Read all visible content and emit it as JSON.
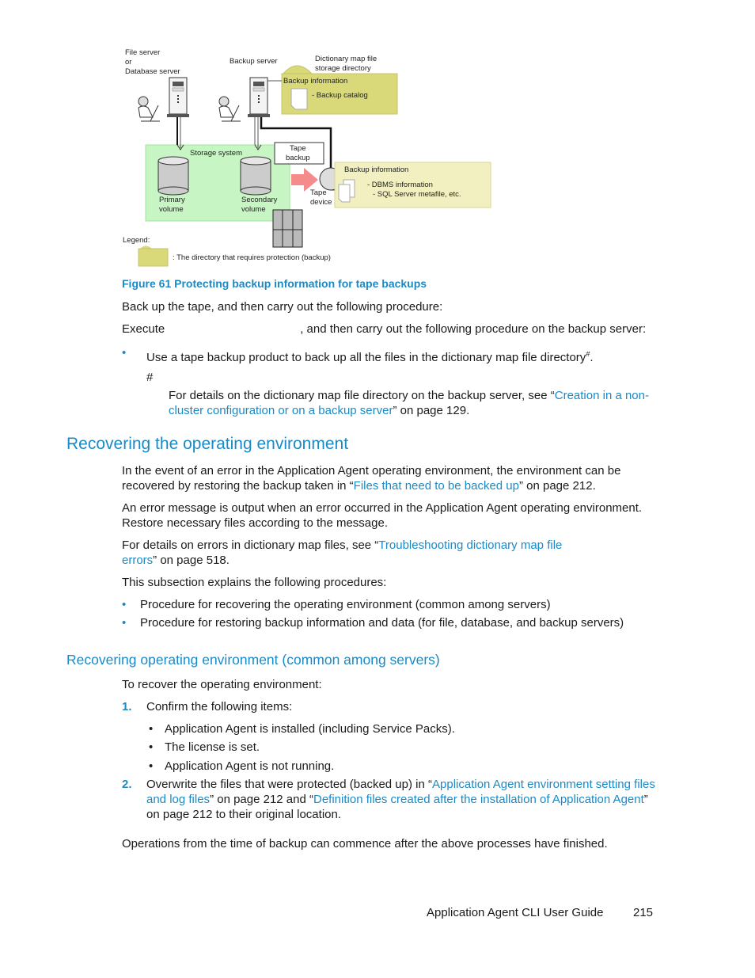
{
  "figure": {
    "labels": {
      "file_server": [
        "File server",
        "or",
        "Database server"
      ],
      "backup_server": "Backup server",
      "dict_dir": [
        "Dictionary map file",
        "storage directory"
      ],
      "backup_info_top": "Backup information",
      "backup_catalog": "- Backup catalog",
      "storage_system": "Storage system",
      "primary": [
        "Primary",
        "volume"
      ],
      "secondary": [
        "Secondary",
        "volume"
      ],
      "tape_backup": [
        "Tape",
        "backup"
      ],
      "tape_device": [
        "Tape",
        "device"
      ],
      "backup_info_bottom": "Backup information",
      "dbms_info": "- DBMS information",
      "sql_meta": "- SQL Server metafile, etc.",
      "legend": "Legend:",
      "legend_desc": ": The directory that requires protection (backup)"
    },
    "colors": {
      "protected_dir": "#d9d97a",
      "backup_info_box": "#f2f0c0",
      "storage_system": "#c8f5c4",
      "arrow": "#f48c8c"
    },
    "caption": "Figure 61 Protecting backup information for tape backups"
  },
  "body1": {
    "p1": "Back up the tape, and then carry out the following procedure:",
    "p2_start": "Execute",
    "p2_end": ", and then carry out the following procedure on the backup server:",
    "bullet": "Use a tape backup product to back up all the files in the dictionary map file directory",
    "bullet_sup": "#",
    "bullet_end": ".",
    "note_mark": "#",
    "note_text": "For details on the dictionary map file directory on the backup server, see “",
    "note_link": "Creation in a non-cluster configuration or on a backup server",
    "note_end": "” on page 129."
  },
  "section1": {
    "heading": "Recovering the operating environment",
    "p1_a": "In the event of an error in the Application Agent operating environment, the environment can be recovered by restoring the backup taken in “",
    "p1_link": "Files that need to be backed up",
    "p1_b": "” on page 212.",
    "p2": "An error message is output when an error occurred in the Application Agent operating environment. Restore necessary files according to the message.",
    "p3_a": "For details on errors in dictionary map files, see “",
    "p3_link": "Troubleshooting dictionary map file errors",
    "p3_b": "” on page 518.",
    "p4": "This subsection explains the following procedures:",
    "bullets": [
      "Procedure for recovering the operating environment (common among servers)",
      "Procedure for restoring backup information and data (for file, database, and backup servers)"
    ]
  },
  "section2": {
    "heading": "Recovering operating environment (common among servers)",
    "intro": "To recover the operating environment:",
    "step1_num": "1.",
    "step1": "Confirm the following items:",
    "step1_items": [
      "Application Agent is installed (including Service Packs).",
      "The license is set.",
      "Application Agent is not running."
    ],
    "step2_num": "2.",
    "step2_a": "Overwrite the files that were protected (backed up) in “",
    "step2_link1": "Application Agent environment setting files and log files",
    "step2_b": "” on page 212 and “",
    "step2_link2": "Definition files created after the installation of Application Agent",
    "step2_c": "” on page 212 to their original location.",
    "closing": "Operations from the time of backup can commence after the above processes have finished."
  },
  "footer": {
    "title": "Application Agent CLI User Guide",
    "page": "215"
  }
}
